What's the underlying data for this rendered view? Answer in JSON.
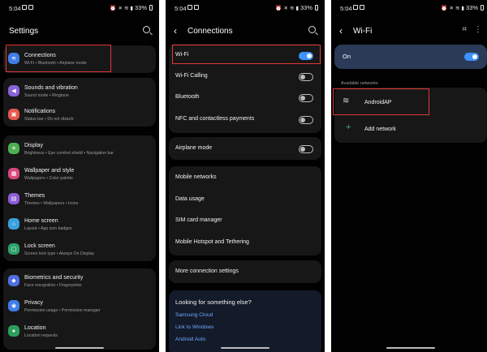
{
  "status_bar": {
    "time": "5:04",
    "battery": "33%"
  },
  "settings": {
    "title": "Settings",
    "items": [
      {
        "label": "Connections",
        "sub": "Wi-Fi  •  Bluetooth  •  Airplane mode",
        "color": "#3f7ee8",
        "icon": "wifi-icon"
      },
      {
        "label": "Sounds and vibration",
        "sub": "Sound mode  •  Ringtone",
        "color": "#8b63d9",
        "icon": "speaker-icon"
      },
      {
        "label": "Notifications",
        "sub": "Status bar  •  Do not disturb",
        "color": "#e5574d",
        "icon": "notification-icon"
      },
      {
        "label": "Display",
        "sub": "Brightness  •  Eye comfort shield  •  Navigation bar",
        "color": "#4caf50",
        "icon": "sun-icon"
      },
      {
        "label": "Wallpaper and style",
        "sub": "Wallpapers  •  Color palette",
        "color": "#d8477c",
        "icon": "wallpaper-icon"
      },
      {
        "label": "Themes",
        "sub": "Themes  •  Wallpapers  •  Icons",
        "color": "#8e5bd9",
        "icon": "themes-icon"
      },
      {
        "label": "Home screen",
        "sub": "Layout  •  App icon badges",
        "color": "#3aa0e0",
        "icon": "home-icon"
      },
      {
        "label": "Lock screen",
        "sub": "Screen lock type  •  Always On Display",
        "color": "#2ea36b",
        "icon": "lock-icon"
      },
      {
        "label": "Biometrics and security",
        "sub": "Face recognition  •  Fingerprints",
        "color": "#4f6fe0",
        "icon": "shield-icon"
      },
      {
        "label": "Privacy",
        "sub": "Permission usage  •  Permission manager",
        "color": "#3f7ee8",
        "icon": "privacy-icon"
      },
      {
        "label": "Location",
        "sub": "Location requests",
        "color": "#2e9e5c",
        "icon": "location-icon"
      }
    ]
  },
  "connections": {
    "title": "Connections",
    "toggles": [
      {
        "label": "Wi-Fi",
        "on": true
      },
      {
        "label": "Wi-Fi Calling",
        "on": false
      },
      {
        "label": "Bluetooth",
        "on": false
      },
      {
        "label": "NFC and contactless payments",
        "on": false
      }
    ],
    "airplane": {
      "label": "Airplane mode",
      "on": false
    },
    "items": [
      {
        "label": "Mobile networks"
      },
      {
        "label": "Data usage"
      },
      {
        "label": "SIM card manager"
      },
      {
        "label": "Mobile Hotspot and Tethering"
      }
    ],
    "more": "More connection settings",
    "suggest": {
      "title": "Looking for something else?",
      "links": [
        "Samsung Cloud",
        "Link to Windows",
        "Android Auto"
      ]
    }
  },
  "wifi": {
    "title": "Wi-Fi",
    "master_label": "On",
    "section_label": "Available networks",
    "network": "AndroidAP",
    "add_label": "Add network"
  }
}
